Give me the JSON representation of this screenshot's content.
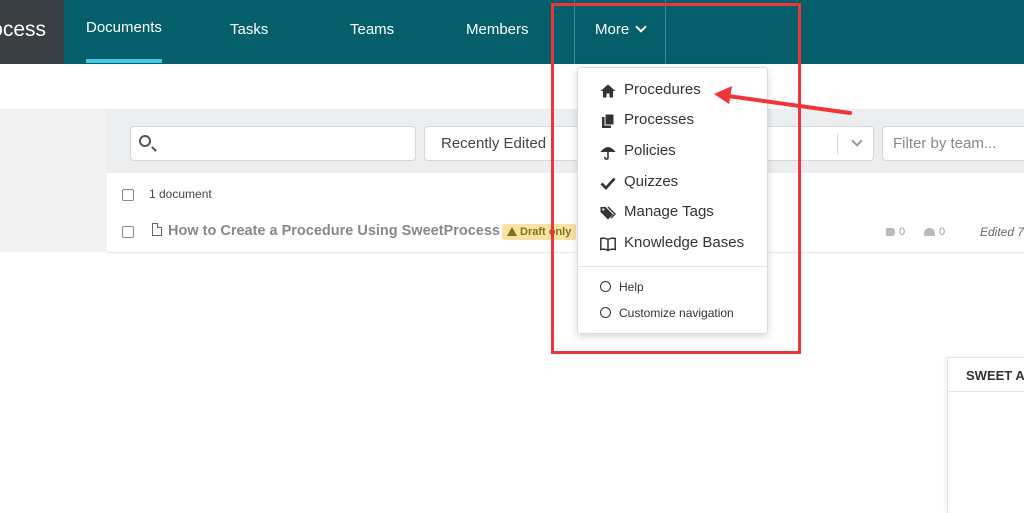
{
  "header": {
    "logo_text": "ocess",
    "nav": [
      {
        "label": "Documents"
      },
      {
        "label": "Tasks"
      },
      {
        "label": "Teams"
      },
      {
        "label": "Members"
      },
      {
        "label": "More"
      }
    ]
  },
  "filters": {
    "search_placeholder": "",
    "sort_value": "Recently Edited",
    "team_placeholder": "Filter by team..."
  },
  "list": {
    "count_label": "1 document",
    "rows": [
      {
        "title": "How to Create a Procedure Using SweetProcess",
        "badge": "Draft only",
        "tags": "0",
        "members": "0",
        "edited": "Edited 7"
      }
    ]
  },
  "menu": {
    "items": [
      {
        "label": "Procedures",
        "icon": "home-icon"
      },
      {
        "label": "Processes",
        "icon": "copy-icon"
      },
      {
        "label": "Policies",
        "icon": "umbrella-icon"
      },
      {
        "label": "Quizzes",
        "icon": "check-icon"
      },
      {
        "label": "Manage Tags",
        "icon": "tags-icon"
      },
      {
        "label": "Knowledge Bases",
        "icon": "book-icon"
      }
    ],
    "secondary": [
      {
        "label": "Help",
        "icon": "question-circle-icon"
      },
      {
        "label": "Customize navigation",
        "icon": "compass-icon"
      }
    ]
  },
  "side_card": {
    "title": "SWEET A"
  },
  "colors": {
    "topbar": "#045f6b",
    "active_underline": "#3fc9e6",
    "annotation_red": "#f0353a",
    "badge_bg": "#f7e3a4"
  }
}
